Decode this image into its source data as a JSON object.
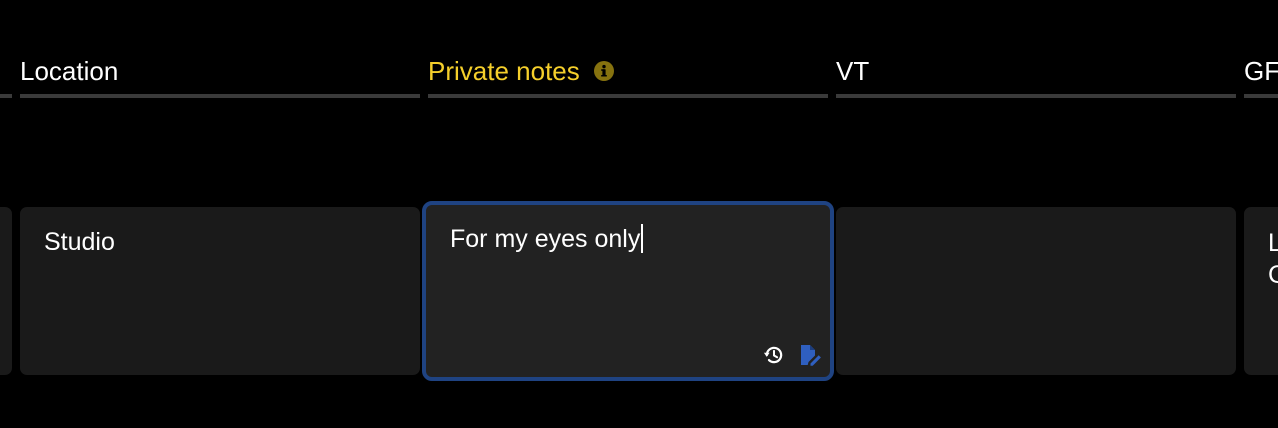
{
  "columns": [
    {
      "label": "",
      "active": false
    },
    {
      "label": "Location",
      "active": false
    },
    {
      "label": "Private notes",
      "active": true,
      "info_icon": "info-circle-icon"
    },
    {
      "label": "VT",
      "active": false
    },
    {
      "label": "GF",
      "active": false
    }
  ],
  "row": {
    "cells": [
      {
        "value": ""
      },
      {
        "value": "Studio"
      },
      {
        "value": "For my eyes only",
        "editing": true
      },
      {
        "value": ""
      },
      {
        "value": "L",
        "value_line2": "C"
      }
    ]
  },
  "editor": {
    "history_icon": "history-icon",
    "edit_note_icon": "file-edit-icon"
  },
  "colors": {
    "background": "#000000",
    "cell_bg": "#1a1a1a",
    "active_header": "#f5cf2b",
    "edit_border": "#1f4382",
    "icon_blue": "#2f5fbf"
  }
}
